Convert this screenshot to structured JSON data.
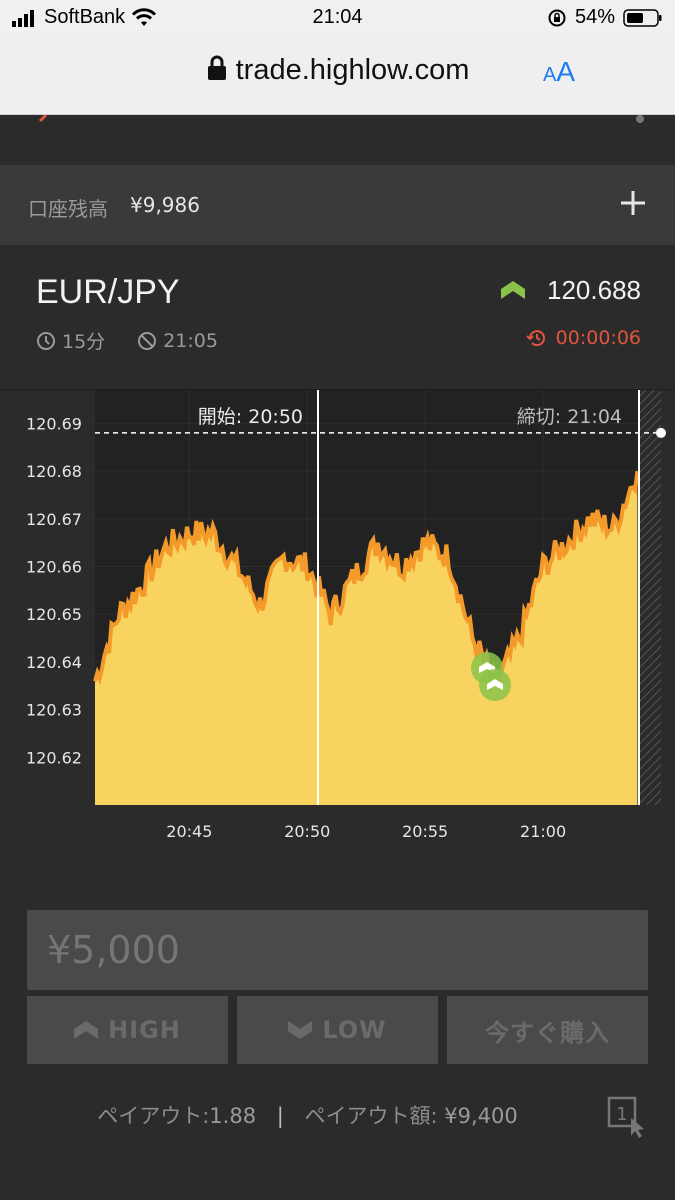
{
  "status_bar": {
    "carrier": "SoftBank",
    "time": "21:04",
    "battery": "54%"
  },
  "browser": {
    "url": "trade.highlow.com",
    "text_size_button": "AA"
  },
  "balance": {
    "label": "口座残高",
    "value": "¥9,986"
  },
  "asset": {
    "pair": "EUR/JPY",
    "price": "120.688",
    "direction_icon": "up-arrow-icon",
    "duration": "15分",
    "expiry": "21:05",
    "countdown": "00:00:06"
  },
  "chart_data": {
    "type": "area",
    "start_label": "開始: 20:50",
    "end_label": "締切: 21:04",
    "y_ticks": [
      "120.69",
      "120.68",
      "120.67",
      "120.66",
      "120.65",
      "120.64",
      "120.63",
      "120.62"
    ],
    "x_ticks": [
      "20:45",
      "20:50",
      "20:55",
      "21:00"
    ],
    "ylim": [
      120.61,
      120.697
    ],
    "xlim": [
      "20:41",
      "21:05"
    ],
    "current_price": 120.688,
    "x": [
      "20:41",
      "20:42",
      "20:43",
      "20:44",
      "20:45",
      "20:46",
      "20:47",
      "20:48",
      "20:49",
      "20:50",
      "20:51",
      "20:52",
      "20:53",
      "20:54",
      "20:55",
      "20:56",
      "20:57",
      "20:58",
      "20:59",
      "21:00",
      "21:01",
      "21:02",
      "21:03",
      "21:04"
    ],
    "values": [
      120.636,
      120.65,
      120.656,
      120.664,
      120.667,
      120.667,
      120.66,
      120.652,
      120.662,
      120.66,
      120.65,
      120.658,
      120.665,
      120.66,
      120.665,
      120.662,
      120.645,
      120.635,
      120.645,
      120.66,
      120.665,
      120.67,
      120.668,
      120.68
    ],
    "fill_color": "#f9d35f",
    "line_color": "#f39a2a"
  },
  "trade": {
    "amount_placeholder": "¥5,000",
    "high_label": "HIGH",
    "low_label": "LOW",
    "buy_now_label": "今すぐ購入"
  },
  "payout": {
    "label": "ペイアウト:",
    "value": "1.88",
    "separator": "|",
    "amount_label": "ペイアウト額:",
    "amount_value": "¥9,400"
  },
  "colors": {
    "accent_green": "#8bc34a",
    "countdown_red": "#e0553e"
  }
}
